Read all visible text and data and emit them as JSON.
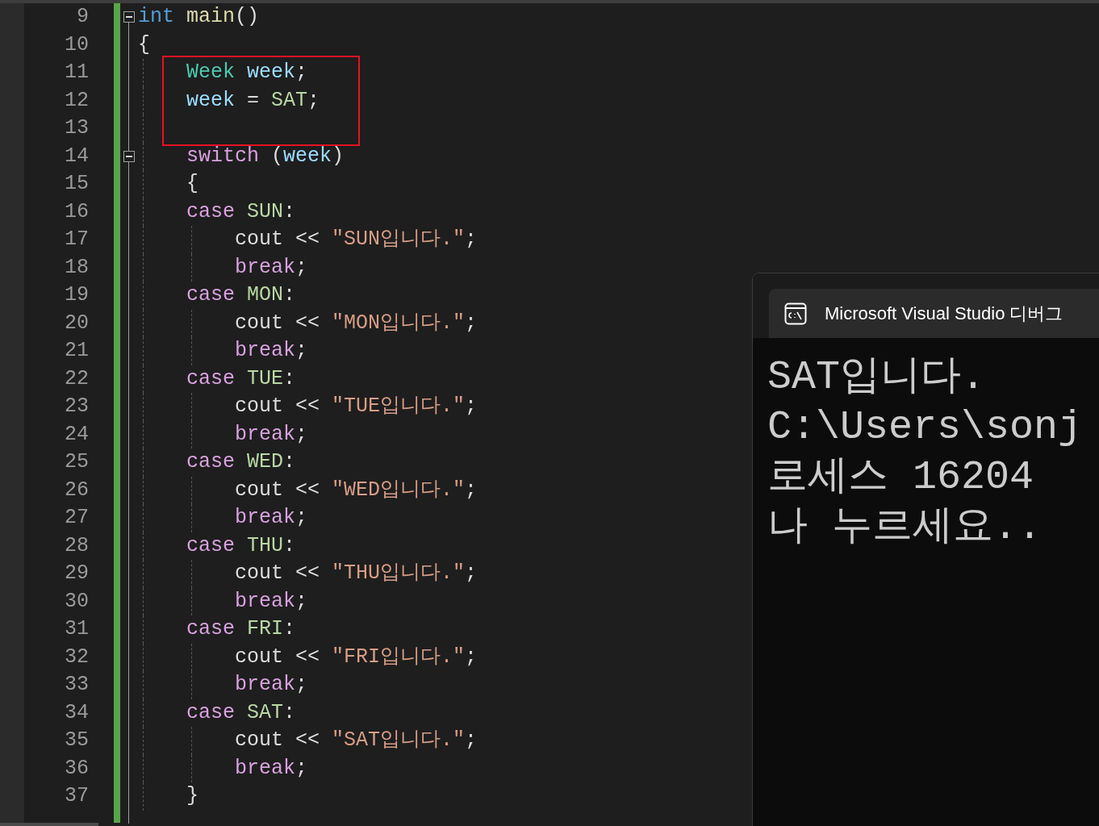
{
  "editor": {
    "lines": [
      {
        "number": "9",
        "fold": true,
        "boxed": false,
        "tokens": [
          {
            "text": "int ",
            "kind": "keyword"
          },
          {
            "text": "main",
            "kind": "function"
          },
          {
            "text": "()",
            "kind": "plain"
          }
        ]
      },
      {
        "number": "10",
        "fold": false,
        "boxed": false,
        "tokens": [
          {
            "text": "{",
            "kind": "plain"
          }
        ],
        "children": [
          {
            "number": "11",
            "fold": false,
            "boxed": true,
            "tokens": [
              {
                "text": "Week ",
                "kind": "type"
              },
              {
                "text": "week",
                "kind": "variable"
              },
              {
                "text": ";",
                "kind": "plain"
              }
            ]
          },
          {
            "number": "12",
            "fold": false,
            "boxed": true,
            "tokens": [
              {
                "text": "week",
                "kind": "variable"
              },
              {
                "text": " = ",
                "kind": "plain"
              },
              {
                "text": "SAT",
                "kind": "enum"
              },
              {
                "text": ";",
                "kind": "plain"
              }
            ]
          },
          {
            "number": "13",
            "fold": false,
            "boxed": true
          },
          {
            "number": "14",
            "fold": true,
            "boxed": false,
            "tokens": [
              {
                "text": "switch",
                "kind": "control"
              },
              {
                "text": " (",
                "kind": "plain"
              },
              {
                "text": "week",
                "kind": "variable"
              },
              {
                "text": ")",
                "kind": "plain"
              }
            ]
          },
          {
            "number": "15",
            "fold": false,
            "boxed": false,
            "tokens": [
              {
                "text": "{",
                "kind": "plain"
              }
            ]
          },
          {
            "number": "16",
            "fold": false,
            "boxed": false,
            "tokens": [
              {
                "text": "case ",
                "kind": "control"
              },
              {
                "text": "SUN",
                "kind": "enum"
              },
              {
                "text": ":",
                "kind": "plain"
              }
            ],
            "children": [
              {
                "number": "17",
                "fold": false,
                "boxed": false,
                "tokens": [
                  {
                    "text": "cout",
                    "kind": "plain"
                  },
                  {
                    "text": " << ",
                    "kind": "plain"
                  },
                  {
                    "text": "\"SUN입니다.\"",
                    "kind": "string"
                  },
                  {
                    "text": ";",
                    "kind": "plain"
                  }
                ]
              },
              {
                "number": "18",
                "fold": false,
                "boxed": false,
                "tokens": [
                  {
                    "text": "break",
                    "kind": "control"
                  },
                  {
                    "text": ";",
                    "kind": "plain"
                  }
                ]
              }
            ]
          },
          {
            "number": "19",
            "fold": false,
            "boxed": false,
            "tokens": [
              {
                "text": "case ",
                "kind": "control"
              },
              {
                "text": "MON",
                "kind": "enum"
              },
              {
                "text": ":",
                "kind": "plain"
              }
            ],
            "children": [
              {
                "number": "20",
                "fold": false,
                "boxed": false,
                "tokens": [
                  {
                    "text": "cout",
                    "kind": "plain"
                  },
                  {
                    "text": " << ",
                    "kind": "plain"
                  },
                  {
                    "text": "\"MON입니다.\"",
                    "kind": "string"
                  },
                  {
                    "text": ";",
                    "kind": "plain"
                  }
                ]
              },
              {
                "number": "21",
                "fold": false,
                "boxed": false,
                "tokens": [
                  {
                    "text": "break",
                    "kind": "control"
                  },
                  {
                    "text": ";",
                    "kind": "plain"
                  }
                ]
              }
            ]
          },
          {
            "number": "22",
            "fold": false,
            "boxed": false,
            "tokens": [
              {
                "text": "case ",
                "kind": "control"
              },
              {
                "text": "TUE",
                "kind": "enum"
              },
              {
                "text": ":",
                "kind": "plain"
              }
            ],
            "children": [
              {
                "number": "23",
                "fold": false,
                "boxed": false,
                "tokens": [
                  {
                    "text": "cout",
                    "kind": "plain"
                  },
                  {
                    "text": " << ",
                    "kind": "plain"
                  },
                  {
                    "text": "\"TUE입니다.\"",
                    "kind": "string"
                  },
                  {
                    "text": ";",
                    "kind": "plain"
                  }
                ]
              },
              {
                "number": "24",
                "fold": false,
                "boxed": false,
                "tokens": [
                  {
                    "text": "break",
                    "kind": "control"
                  },
                  {
                    "text": ";",
                    "kind": "plain"
                  }
                ]
              }
            ]
          },
          {
            "number": "25",
            "fold": false,
            "boxed": false,
            "tokens": [
              {
                "text": "case ",
                "kind": "control"
              },
              {
                "text": "WED",
                "kind": "enum"
              },
              {
                "text": ":",
                "kind": "plain"
              }
            ],
            "children": [
              {
                "number": "26",
                "fold": false,
                "boxed": false,
                "tokens": [
                  {
                    "text": "cout",
                    "kind": "plain"
                  },
                  {
                    "text": " << ",
                    "kind": "plain"
                  },
                  {
                    "text": "\"WED입니다.\"",
                    "kind": "string"
                  },
                  {
                    "text": ";",
                    "kind": "plain"
                  }
                ]
              },
              {
                "number": "27",
                "fold": false,
                "boxed": false,
                "tokens": [
                  {
                    "text": "break",
                    "kind": "control"
                  },
                  {
                    "text": ";",
                    "kind": "plain"
                  }
                ]
              }
            ]
          },
          {
            "number": "28",
            "fold": false,
            "boxed": false,
            "tokens": [
              {
                "text": "case ",
                "kind": "control"
              },
              {
                "text": "THU",
                "kind": "enum"
              },
              {
                "text": ":",
                "kind": "plain"
              }
            ],
            "children": [
              {
                "number": "29",
                "fold": false,
                "boxed": false,
                "tokens": [
                  {
                    "text": "cout",
                    "kind": "plain"
                  },
                  {
                    "text": " << ",
                    "kind": "plain"
                  },
                  {
                    "text": "\"THU입니다.\"",
                    "kind": "string"
                  },
                  {
                    "text": ";",
                    "kind": "plain"
                  }
                ]
              },
              {
                "number": "30",
                "fold": false,
                "boxed": false,
                "tokens": [
                  {
                    "text": "break",
                    "kind": "control"
                  },
                  {
                    "text": ";",
                    "kind": "plain"
                  }
                ]
              }
            ]
          },
          {
            "number": "31",
            "fold": false,
            "boxed": false,
            "tokens": [
              {
                "text": "case ",
                "kind": "control"
              },
              {
                "text": "FRI",
                "kind": "enum"
              },
              {
                "text": ":",
                "kind": "plain"
              }
            ],
            "children": [
              {
                "number": "32",
                "fold": false,
                "boxed": false,
                "tokens": [
                  {
                    "text": "cout",
                    "kind": "plain"
                  },
                  {
                    "text": " << ",
                    "kind": "plain"
                  },
                  {
                    "text": "\"FRI입니다.\"",
                    "kind": "string"
                  },
                  {
                    "text": ";",
                    "kind": "plain"
                  }
                ]
              },
              {
                "number": "33",
                "fold": false,
                "boxed": false,
                "tokens": [
                  {
                    "text": "break",
                    "kind": "control"
                  },
                  {
                    "text": ";",
                    "kind": "plain"
                  }
                ]
              }
            ]
          },
          {
            "number": "34",
            "fold": false,
            "boxed": false,
            "tokens": [
              {
                "text": "case ",
                "kind": "control"
              },
              {
                "text": "SAT",
                "kind": "enum"
              },
              {
                "text": ":",
                "kind": "plain"
              }
            ],
            "children": [
              {
                "number": "35",
                "fold": false,
                "boxed": false,
                "tokens": [
                  {
                    "text": "cout",
                    "kind": "plain"
                  },
                  {
                    "text": " << ",
                    "kind": "plain"
                  },
                  {
                    "text": "\"SAT입니다.\"",
                    "kind": "string"
                  },
                  {
                    "text": ";",
                    "kind": "plain"
                  }
                ]
              },
              {
                "number": "36",
                "fold": false,
                "boxed": false,
                "tokens": [
                  {
                    "text": "break",
                    "kind": "control"
                  },
                  {
                    "text": ";",
                    "kind": "plain"
                  }
                ]
              }
            ]
          },
          {
            "number": "37",
            "fold": false,
            "boxed": false,
            "tokens": [
              {
                "text": "}",
                "kind": "plain"
              }
            ]
          }
        ]
      }
    ]
  },
  "console": {
    "title": "Microsoft Visual Studio 디버그",
    "output": [
      "SAT입니다.",
      "C:\\Users\\sonj",
      "로세스 16204",
      "나 누르세요.."
    ]
  }
}
